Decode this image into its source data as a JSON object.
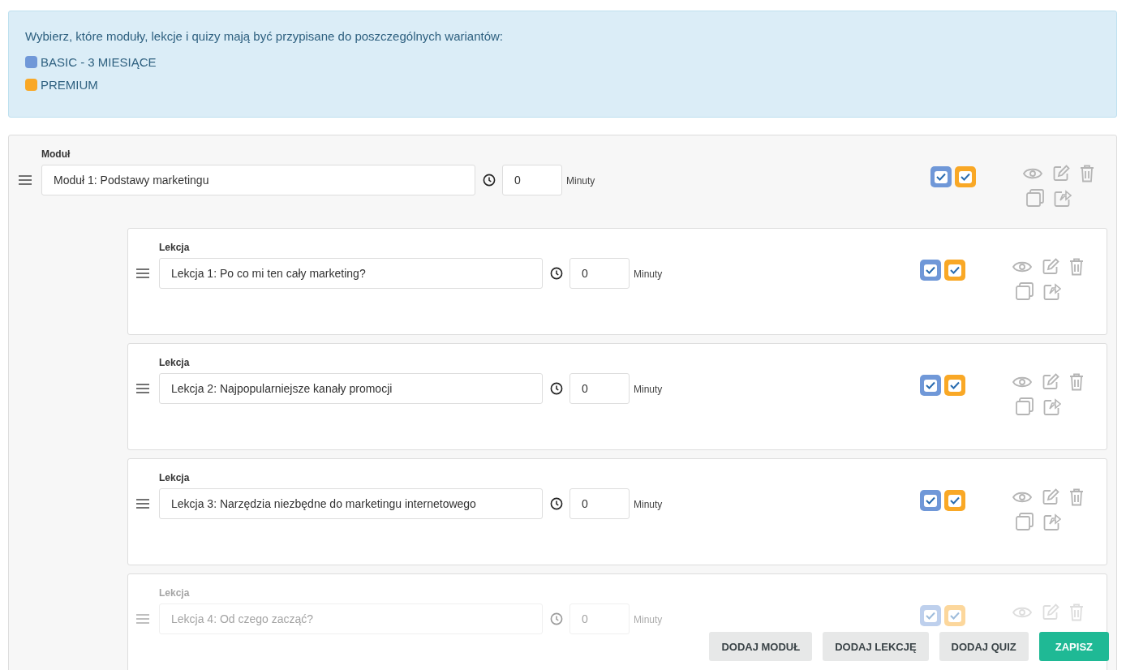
{
  "info": {
    "text": "Wybierz, które moduły, lekcje i quizy mają być przypisane do poszczególnych wariantów:",
    "variants": [
      {
        "name": "BASIC - 3 MIESIĄCE",
        "color": "#7098d8"
      },
      {
        "name": "PREMIUM",
        "color": "#f9a826"
      }
    ]
  },
  "module": {
    "label": "Moduł",
    "title": "Moduł 1: Podstawy marketingu",
    "minutes": "0",
    "unit": "Minuty",
    "variants": [
      {
        "checked": true
      },
      {
        "checked": true
      }
    ],
    "lessons": [
      {
        "label": "Lekcja",
        "title": "Lekcja 1: Po co mi ten cały marketing?",
        "minutes": "0",
        "unit": "Minuty",
        "variants": [
          {
            "checked": true
          },
          {
            "checked": true
          }
        ]
      },
      {
        "label": "Lekcja",
        "title": "Lekcja 2: Najpopularniejsze kanały promocji",
        "minutes": "0",
        "unit": "Minuty",
        "variants": [
          {
            "checked": true
          },
          {
            "checked": true
          }
        ]
      },
      {
        "label": "Lekcja",
        "title": "Lekcja 3: Narzędzia niezbędne do marketingu internetowego",
        "minutes": "0",
        "unit": "Minuty",
        "variants": [
          {
            "checked": true
          },
          {
            "checked": true
          }
        ]
      },
      {
        "label": "Lekcja",
        "title": "Lekcja 4: Od czego zacząć?",
        "minutes": "0",
        "unit": "Minuty",
        "variants": [
          {
            "checked": true
          },
          {
            "checked": true
          }
        ]
      }
    ]
  },
  "footer": {
    "buttons": [
      {
        "label": "DODAJ MODUŁ",
        "kind": "secondary"
      },
      {
        "label": "DODAJ LEKCJĘ",
        "kind": "secondary"
      },
      {
        "label": "DODAJ QUIZ",
        "kind": "secondary"
      },
      {
        "label": "ZAPISZ",
        "kind": "primary"
      }
    ]
  }
}
